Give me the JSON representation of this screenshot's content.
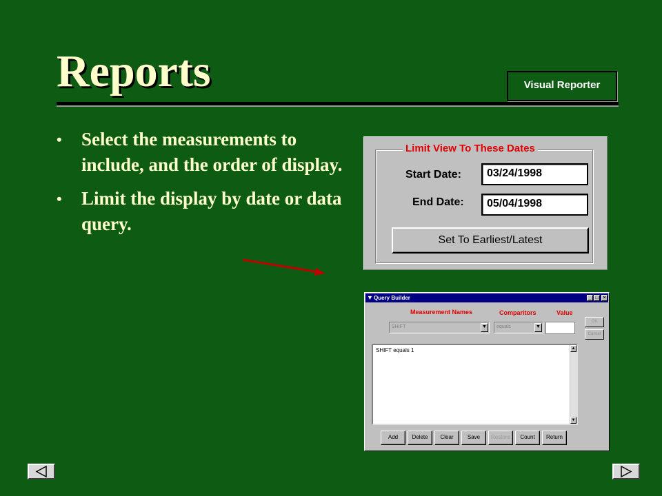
{
  "slide": {
    "title": "Reports",
    "badge": "Visual Reporter",
    "bullets": [
      "Select the measurements to include, and the order of display.",
      "Limit the display by date or data query."
    ]
  },
  "date_panel": {
    "group_label": "Limit View To These Dates",
    "start_label": "Start Date:",
    "start_value": "03/24/1998",
    "end_label": "End Date:",
    "end_value": "05/04/1998",
    "button_label": "Set To Earliest/Latest"
  },
  "query_builder": {
    "title": "Query Builder",
    "headers": {
      "names": "Measurement Names",
      "comparitors": "Comparitors",
      "value": "Value"
    },
    "measurement_value": "SHIFT",
    "comparitor_value": "equals",
    "value_input": "",
    "ok_label": "OK",
    "cancel_label": "Cancel",
    "query_text": "SHIFT equals 1",
    "buttons": [
      "Add",
      "Delete",
      "Clear",
      "Save",
      "Restore",
      "Count",
      "Return"
    ]
  },
  "colors": {
    "background": "#0e5c14",
    "title_text": "#ffffcc",
    "accent_red": "#e00000",
    "arrow": "#c00000"
  }
}
